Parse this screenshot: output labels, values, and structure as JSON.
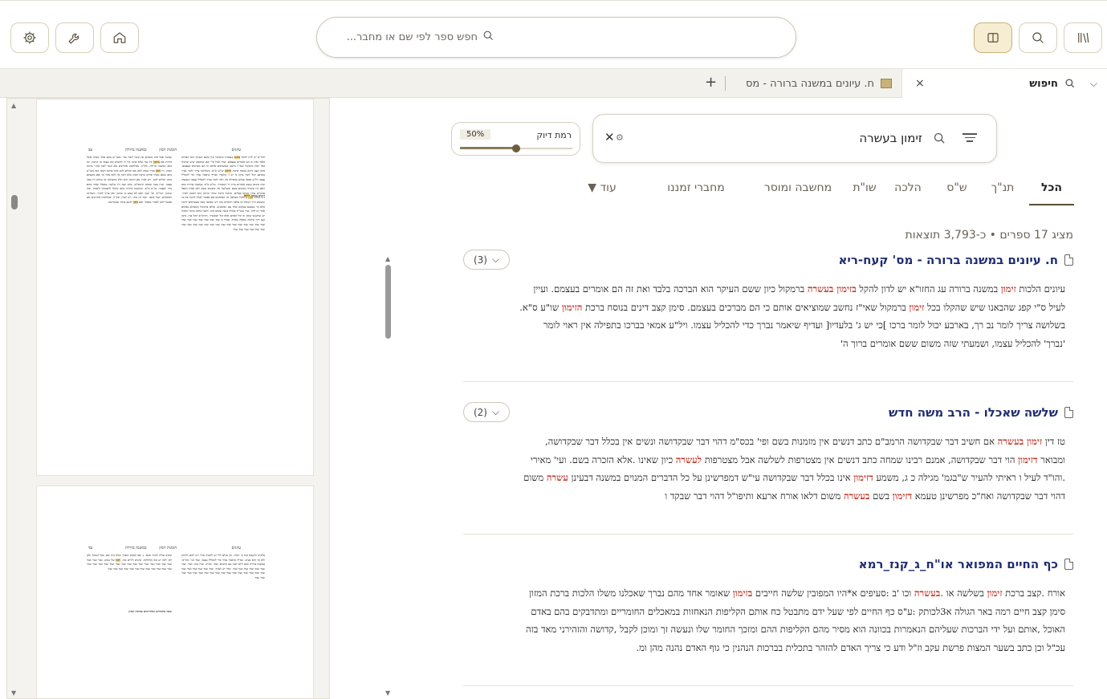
{
  "toolbar": {
    "search_placeholder": "חפש ספר לפי שם או מחבר...",
    "buttons": [
      "settings-icon",
      "tools-icon",
      "home-icon",
      "library-view-icon",
      "search-icon",
      "books-icon"
    ]
  },
  "tabs": {
    "search_tab_label": "חיפוש",
    "book_tab_label": "ח. עיונים במשנה ברורה - מס",
    "add_label": "+",
    "close_label": "×",
    "chevron_label": "⌵"
  },
  "pdf": {
    "page1_header_right": "עיונים",
    "page1_header_left": "במשנה ברורה",
    "page1_header_mid": "הזמנת זימון",
    "page1_pnum": "צב",
    "page2_header_right": "עיונים",
    "page2_header_left": "במשנה ברורה",
    "page2_header_mid": "הזמנת זימון",
    "page2_pnum": "עד",
    "page2_section": "שאר מחבורים המחוייבים בברכת המזון"
  },
  "search": {
    "query": "זימון בעשרה",
    "clear_label": "✕",
    "precision_label": "רמת דיוק",
    "precision_value": "50%",
    "precision_fraction": 0.5
  },
  "categories": [
    {
      "label": "הכל",
      "active": true
    },
    {
      "label": "תנ\"ך",
      "active": false
    },
    {
      "label": "ש\"ס",
      "active": false
    },
    {
      "label": "הלכה",
      "active": false
    },
    {
      "label": "שו\"ת",
      "active": false
    },
    {
      "label": "מחשבה ומוסר",
      "active": false
    },
    {
      "label": "מחברי זמננו",
      "active": false
    },
    {
      "label": "עוד ▼",
      "active": false
    }
  ],
  "summary": "מציג 17 ספרים • כ-3,793 תוצאות",
  "results": [
    {
      "title": "ח. עיונים במשנה ברורה - מס' קעח-ריא",
      "count": "(3)",
      "lines": [
        "עיונים הלכות <b class='r'>זימון</b> במשנה ברורה עג החזו\"א יש לדון להקל <b class='r'>בזימון בעשרה</b> ברמקול כיון ששם העיקר הוא הברכה בלבד ואת זה הם אומרים בעצמם. ועיין",
        "לעיל ס\"י קפג שהבאנו שיש שהקלו בכל <b class='r'>זימון</b> ברמקול שאי\"ז נחשב שמוציאים אותם כי הם מברכים בעצמם. סימן קצב דינים בנוסח ברכת <b class='r'>הזימון</b> שו\"ע ס\"א.",
        "בשלושה צריך לומר נב רך, בארבע יכול לומר ברכו ]כי יש ג' בלעדיו[ ועדיף שיאמר נברך כדי להכליל עצמו. ויל\"ע אמאי בברכו בתפילה אין ראוי לומר",
        "'נברך' להכליל עצמו, ושמעתי שזה משום ששם אומרים ברוך ה'"
      ]
    },
    {
      "title": "שלשה שאכלו - הרב משה חדש",
      "count": "(2)",
      "lines": [
        "טז דין <b class='r'>זימון בעשרה</b> אם חשיב דבר שבקדושה הרמב\"ם כתב דנשים אין מזמנות בשם ופי' בכס\"מ דהוי דבר שבקדושה ונשים אין בכלל דבר שבקדושה,",
        "ומבואר <b class='r'>דזימון</b> הוי דבר שבקדושה, אמנם רבינו שמחה כתב דנשים אין מצטרפות לשלשה אבל מצטרפות <b class='r'>לעשרה</b> כיון שאינו .אלא הזכרה בשם. ועי' מאירי",
        ".והו\"ד לעיל ו ראיתי להעיר ש\"בגמ' מגילה כ ג, משמע <b class='r'>דזימון</b> אינו בכלל דבר שבקדושה עי\"ש דמפרשינן על כל הדברים המנוים במשנה דבעינן <b class='r'>עשרה</b> משום",
        "דהוי דבר שבקדושה ואח\"כ מפרשינן טעמא <b class='r'>דזימון</b> בשם <b class='r'>בעשרה</b> משום דלאו אורח ארעא ותיפו\"ל דהוי דבר שבקד ו"
      ]
    },
    {
      "title": "כף החיים המפואר או\"ח_ג_קנז_רמא",
      "count": "",
      "lines": [
        "אורח .קצב ברכת <b class='r'>זימון</b> בשלשה או .<b class='r'>בעשרה</b> וכו 'ב :סעיפים א*היו המפובין שלשה חייבים <b class='r'>בזימון</b> שאומר אחד מהם נברך שאכלנו משלו הלכות ברכת המזון",
        "סימן קצב חיים רמה באר הגולה א3לכותק :ע\"ס כף החיים לפי שעל ידם מתבטל כח אותם הקליפות הנאחזות במאכלים החומריים ומתדבקים בהם באדם",
        "האוכל ,אותם ועל ידי הברכות שעליהם הנאמרות בכוונה הוא מסיר מהם הקליפות ההם ומזכך החומר שלו ונעשה זך ומוכן לקבל ,קדושה והזהירני מאד בזה",
        "עכ\"ל וכן כתב בשער המצות פרשת עקב וז\"ל ודע כי צריך האדם להזהר בתכלית בברכות הנהנין כי גוף האדם נהנה מהן ומ."
      ]
    }
  ]
}
